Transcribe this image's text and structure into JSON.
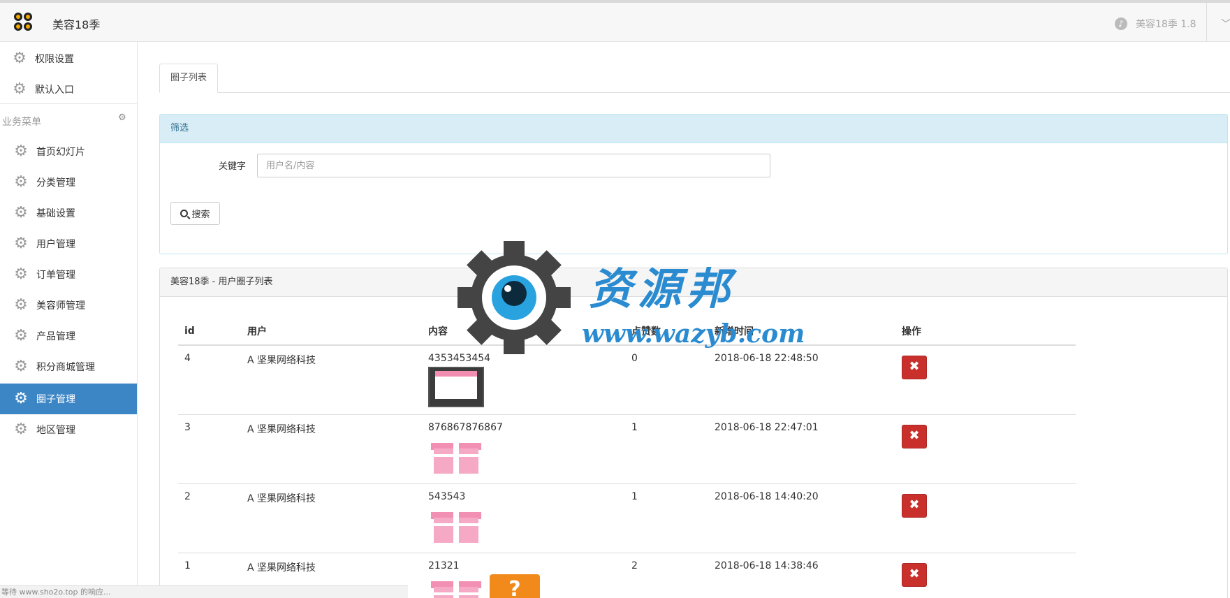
{
  "header": {
    "brand": "美容18季",
    "version": "美容18季 1.8"
  },
  "sidebar": {
    "top_items": [
      {
        "label": "权限设置"
      },
      {
        "label": "默认入口"
      }
    ],
    "group_title": "业务菜单",
    "items": [
      {
        "label": "首页幻灯片"
      },
      {
        "label": "分类管理"
      },
      {
        "label": "基础设置"
      },
      {
        "label": "用户管理"
      },
      {
        "label": "订单管理"
      },
      {
        "label": "美容师管理"
      },
      {
        "label": "产品管理"
      },
      {
        "label": "积分商城管理"
      },
      {
        "label": "圈子管理",
        "active": true
      },
      {
        "label": "地区管理"
      }
    ]
  },
  "tabs": [
    {
      "label": "圈子列表"
    }
  ],
  "filter": {
    "title": "筛选",
    "keyword_label": "关键字",
    "keyword_placeholder": "用户名/内容",
    "search_button": "搜索"
  },
  "list": {
    "title": "美容18季 - 用户圈子列表",
    "columns": [
      "id",
      "用户",
      "内容",
      "点赞数",
      "新增时间",
      "操作"
    ],
    "rows": [
      {
        "id": "4",
        "user": "A 坚果网络科技",
        "content": "4353453454",
        "images": [
          "phone"
        ],
        "likes": "0",
        "time": "2018-06-18 22:48:50"
      },
      {
        "id": "3",
        "user": "A 坚果网络科技",
        "content": "876867876867",
        "images": [
          "gift"
        ],
        "likes": "1",
        "time": "2018-06-18 22:47:01"
      },
      {
        "id": "2",
        "user": "A 坚果网络科技",
        "content": "543543",
        "images": [
          "gift"
        ],
        "likes": "1",
        "time": "2018-06-18 14:40:20"
      },
      {
        "id": "1",
        "user": "A 坚果网络科技",
        "content": "21321",
        "images": [
          "gift",
          "question"
        ],
        "likes": "2",
        "time": "2018-06-18 14:38:46"
      }
    ],
    "delete_symbol": "✖"
  },
  "watermark": {
    "title": "资源邦",
    "url": "www.wazyb.com"
  },
  "statusbar": "等待 www.sho2o.top 的响应...",
  "colors": {
    "accent": "#3d86c6",
    "danger": "#c9302c",
    "info_bg": "#d9edf7"
  }
}
